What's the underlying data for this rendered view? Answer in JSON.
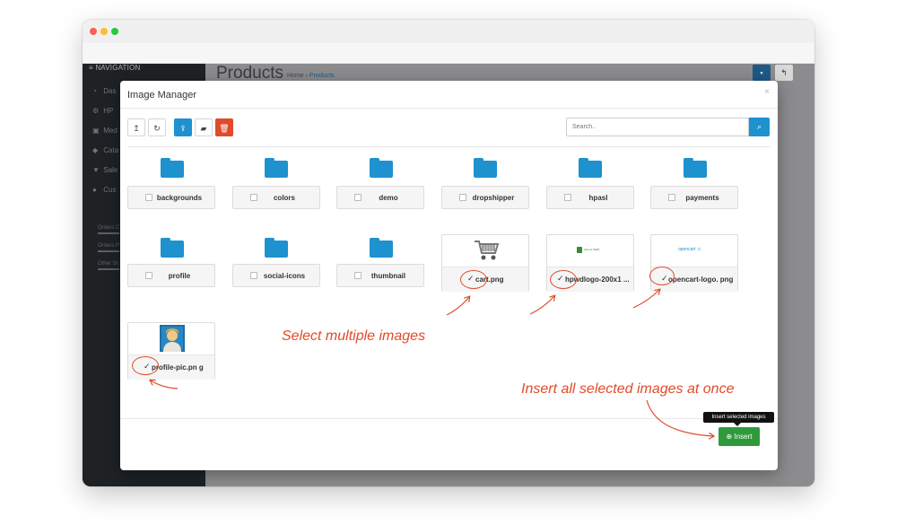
{
  "background_app": {
    "nav_title": "NAVIGATION",
    "nav_items": [
      {
        "icon": "dashboard-icon",
        "label": "Das"
      },
      {
        "icon": "cogs-icon",
        "label": "HP"
      },
      {
        "icon": "image-icon",
        "label": "Med"
      },
      {
        "icon": "tag-icon",
        "label": "Cata"
      },
      {
        "icon": "cart-icon",
        "label": "Sale"
      },
      {
        "icon": "user-icon",
        "label": "Cus"
      }
    ],
    "nav_subs": [
      "Orders C",
      "Orders P",
      "Other St"
    ],
    "page_title": "Products",
    "breadcrumb": {
      "home": "Home",
      "current": "Products"
    }
  },
  "modal": {
    "title": "Image Manager",
    "close": "×",
    "toolbar": {
      "parent": "↥",
      "refresh": "↻",
      "upload": "⇪",
      "folder": "▰",
      "delete": "🗑"
    },
    "search": {
      "placeholder": "Search.."
    },
    "folders": [
      "backgrounds",
      "colors",
      "demo",
      "dropshipper",
      "hpasl",
      "payments",
      "profile",
      "social-icons",
      "thumbnail"
    ],
    "images": [
      {
        "name": "cart.png",
        "checked": true,
        "thumb": "cart-thumbnail"
      },
      {
        "name": "hpwdlogo-200x1 ...",
        "checked": true,
        "thumb": "hpwd-logo-thumbnail"
      },
      {
        "name": "opencart-logo. png",
        "checked": true,
        "thumb": "opencart-logo-thumbnail"
      },
      {
        "name": "profile-pic.pn g",
        "checked": true,
        "thumb": "profile-pic-thumbnail"
      }
    ],
    "thumb_texts": {
      "hpwd": "HALAL WEB",
      "opencart": "opencart"
    },
    "tooltip": "Insert selected images",
    "insert_label": "Insert",
    "insert_icon": "⊕"
  },
  "annotations": {
    "select_multiple": "Select multiple images",
    "insert_all": "Insert all selected images at once"
  },
  "colors": {
    "accent_blue": "#1e91cf",
    "delete_red": "#e04b2b",
    "insert_green": "#2f9a3b",
    "annotation_red": "#e04b2b"
  }
}
